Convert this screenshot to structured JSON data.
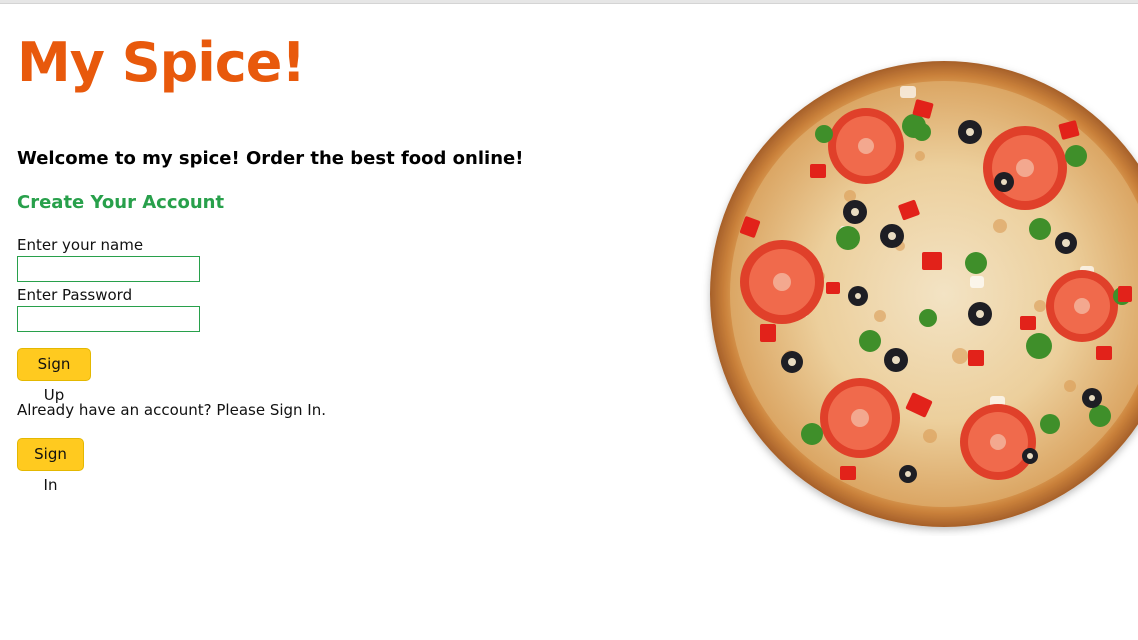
{
  "brand": {
    "title": "My Spice!",
    "color": "#e8590c"
  },
  "welcome_text": "Welcome to my spice! Order the best food online!",
  "signup_form": {
    "heading": "Create Your Account",
    "heading_color": "#28a04b",
    "name_label": "Enter your name",
    "name_value": "",
    "password_label": "Enter Password",
    "password_value": "",
    "submit_label": "Sign Up"
  },
  "signin": {
    "prompt": "Already have an account? Please Sign In.",
    "button_label": "Sign In"
  },
  "colors": {
    "button_bg": "#ffca1f",
    "input_border": "#28a04b"
  },
  "hero_image": {
    "subject": "pizza-image"
  }
}
